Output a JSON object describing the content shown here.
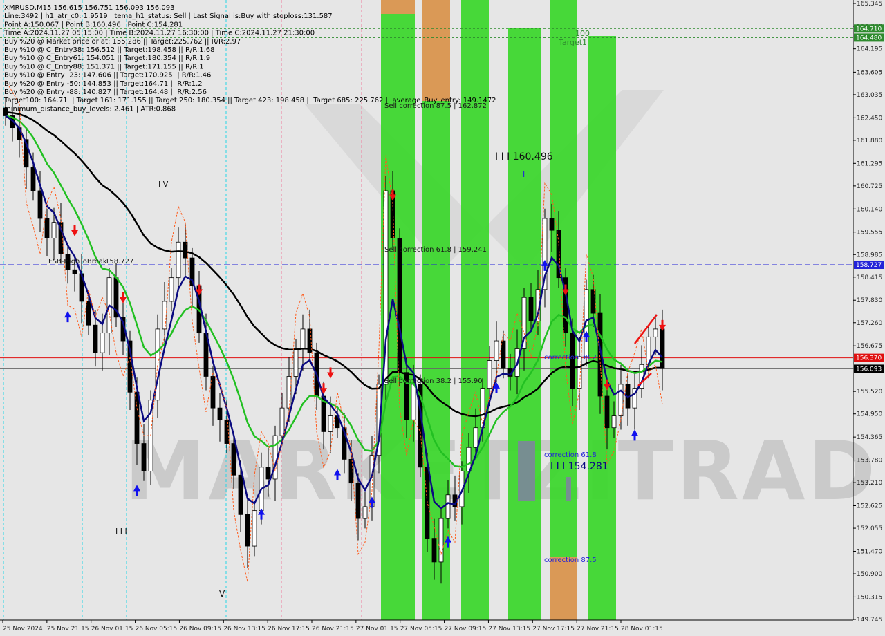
{
  "chart_data": {
    "type": "candlestick",
    "header": [
      "XMRUSD,M15  156.615 156.751 156.093 156.093",
      "Line:3492 | h1_atr_c0: 1.9519 | tema_h1_status: Sell | Last Signal is:Buy with stoploss:131.587",
      "Point A:150.067 | Point B:160.496 | Point C:154.281",
      "Time A:2024.11.27 05:15:00 | Time B:2024.11.27 16:30:00 | Time C:2024.11.27 21:30:00",
      "Buy %20 @ Market price or at: 155.286 || Target:225.762 || R/R:2.97",
      "Buy %10 @ C_Entry38: 156.512 || Target:198.458 || R/R:1.68",
      "Buy %10 @ C_Entry61: 154.051 || Target:180.354 || R/R:1.9",
      "Buy %10 @ C_Entry88: 151.371 || Target:171.155 || R/R:1",
      "Buy %10 @ Entry -23: 147.606 || Target:170.925 || R/R:1.46",
      "Buy %20 @ Entry -50: 144.853 || Target:164.71 || R/R:1.2",
      "Buy %20 @ Entry -88: 140.827 || Target:164.48 || R/R:2.56",
      "Target100: 164.71 || Target 161: 171.155 || Target 250: 180.354 || Target 423: 198.458 || Target 685: 225.762 || average_Buy_entry: 149.1472",
      "minimum_distance_buy_levels: 2.461 | ATR:0.868"
    ],
    "y_ticks": [
      "165.345",
      "164.770",
      "164.195",
      "163.605",
      "163.035",
      "162.450",
      "161.880",
      "161.295",
      "160.725",
      "160.140",
      "159.555",
      "158.985",
      "158.415",
      "157.830",
      "157.260",
      "156.675",
      "156.105",
      "155.520",
      "154.950",
      "154.365",
      "153.780",
      "153.210",
      "152.625",
      "152.055",
      "151.470",
      "150.900",
      "150.315",
      "149.745"
    ],
    "ylim": [
      149.745,
      165.345
    ],
    "x_ticks": [
      "25 Nov 2024",
      "25 Nov 21:15",
      "26 Nov 01:15",
      "26 Nov 05:15",
      "26 Nov 09:15",
      "26 Nov 13:15",
      "26 Nov 17:15",
      "26 Nov 21:15",
      "27 Nov 01:15",
      "27 Nov 05:15",
      "27 Nov 09:15",
      "27 Nov 13:15",
      "27 Nov 17:15",
      "27 Nov 21:15",
      "28 Nov 01:15"
    ],
    "price_badges": [
      {
        "value": "164.710",
        "color": "#2e8b2e"
      },
      {
        "value": "164.480",
        "color": "#2e8b2e"
      },
      {
        "value": "158.727",
        "color": "#2323d8"
      },
      {
        "value": "156.370",
        "color": "#e01010"
      },
      {
        "value": "156.093",
        "color": "#000000"
      }
    ],
    "annotations": [
      "Sell correction 87.5 | 162.872",
      "Sell correction 61.8 | 159.241",
      "Sell correction 38.2 | 155.90",
      "I I I 160.496",
      "I I I 154.281",
      "correction 38.2",
      "correction 61.8",
      "correction 87.5",
      "FSB-HighToBreak",
      "158.727",
      "100",
      "Target1",
      "V",
      "I V",
      "I I I",
      "I"
    ],
    "watermark": "MARKETZITRADE",
    "close_series": [
      162.5,
      162.2,
      161.9,
      161.2,
      160.6,
      159.9,
      159.4,
      159.8,
      159.0,
      158.6,
      158.5,
      157.8,
      157.2,
      156.5,
      157.0,
      158.4,
      157.4,
      156.8,
      155.5,
      154.2,
      153.5,
      155.3,
      157.1,
      157.8,
      158.4,
      159.3,
      158.9,
      158.2,
      157.0,
      155.9,
      155.1,
      154.8,
      154.2,
      153.4,
      152.4,
      151.6,
      152.5,
      153.6,
      153.3,
      154.4,
      155.1,
      155.9,
      156.6,
      157.1,
      156.5,
      155.4,
      154.5,
      154.9,
      154.6,
      153.8,
      153.2,
      152.3,
      152.6,
      153.9,
      155.7,
      160.6,
      159.4,
      156.0,
      154.8,
      155.7,
      153.6,
      151.8,
      151.2,
      152.3,
      152.9,
      152.6,
      153.5,
      154.1,
      154.6,
      155.6,
      156.3,
      156.8,
      156.1,
      155.9,
      156.6,
      157.9,
      157.3,
      158.1,
      159.9,
      159.6,
      158.4,
      157.0,
      155.6,
      156.4,
      158.1,
      157.5,
      155.4,
      154.6,
      154.9,
      155.7,
      155.1,
      155.6,
      156.2,
      156.9,
      157.1,
      156.1
    ],
    "colors": {
      "zone_green": "#39d72a",
      "zone_orange": "#d9924a",
      "zone_grey": "#7c8899",
      "ema_black": "#000000",
      "ema_green": "#22c022",
      "tema_navy": "#0a0a80",
      "resistance_red": "#e01010",
      "fsb_blue": "#2323d8",
      "target_green": "#2e8b2e"
    }
  }
}
